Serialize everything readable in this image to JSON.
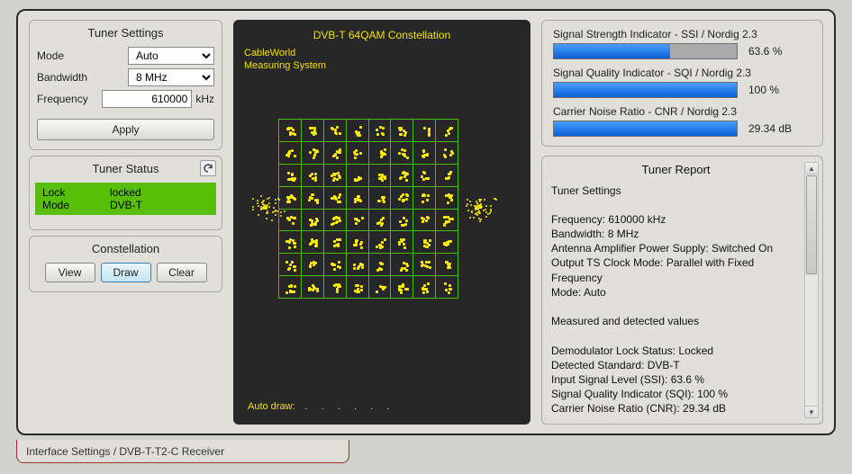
{
  "tuner_settings": {
    "title": "Tuner Settings",
    "mode_label": "Mode",
    "mode_value": "Auto",
    "bandwidth_label": "Bandwidth",
    "bandwidth_value": "8 MHz",
    "frequency_label": "Frequency",
    "frequency_value": "610000",
    "frequency_unit": "kHz",
    "apply_label": "Apply"
  },
  "tuner_status": {
    "title": "Tuner Status",
    "lock_label": "Lock",
    "lock_value": "locked",
    "mode_label": "Mode",
    "mode_value": "DVB-T"
  },
  "constellation_ctrl": {
    "title": "Constellation",
    "view_label": "View",
    "draw_label": "Draw",
    "clear_label": "Clear"
  },
  "constellation_display": {
    "title": "DVB-T 64QAM Constellation",
    "subtitle1": "CableWorld",
    "subtitle2": "Measuring System",
    "autodraw_label": "Auto draw:",
    "autodraw_dots": ". . . . . ."
  },
  "metrics": {
    "ssi_label": "Signal Strength Indicator - SSI / Nordig 2.3",
    "ssi_value": "63.6 %",
    "ssi_pct": 63.6,
    "sqi_label": "Signal Quality Indicator - SQI / Nordig 2.3",
    "sqi_value": "100 %",
    "sqi_pct": 100,
    "cnr_label": "Carrier Noise Ratio - CNR / Nordig 2.3",
    "cnr_value": "29.34 dB",
    "cnr_pct": 100
  },
  "report": {
    "title": "Tuner Report",
    "lines": {
      "l0": "Tuner Settings",
      "l1": "",
      "l2": "Frequency: 610000 kHz",
      "l3": "Bandwidth: 8 MHz",
      "l4": "Antenna Amplifier Power Supply: Switched On",
      "l5": "Output TS Clock Mode: Parallel with Fixed Frequency",
      "l6": "Mode: Auto",
      "l7": "",
      "l8": "Measured and detected values",
      "l9": "",
      "l10": "Demodulator Lock Status: Locked",
      "l11": "Detected Standard: DVB-T",
      "l12": "Input Signal Level (SSI): 63.6 %",
      "l13": "Signal Quality Indicator (SQI): 100 %",
      "l14": "Carrier Noise Ratio (CNR): 29.34 dB"
    }
  },
  "tab": {
    "label": "Interface Settings / DVB-T-T2-C Receiver"
  }
}
